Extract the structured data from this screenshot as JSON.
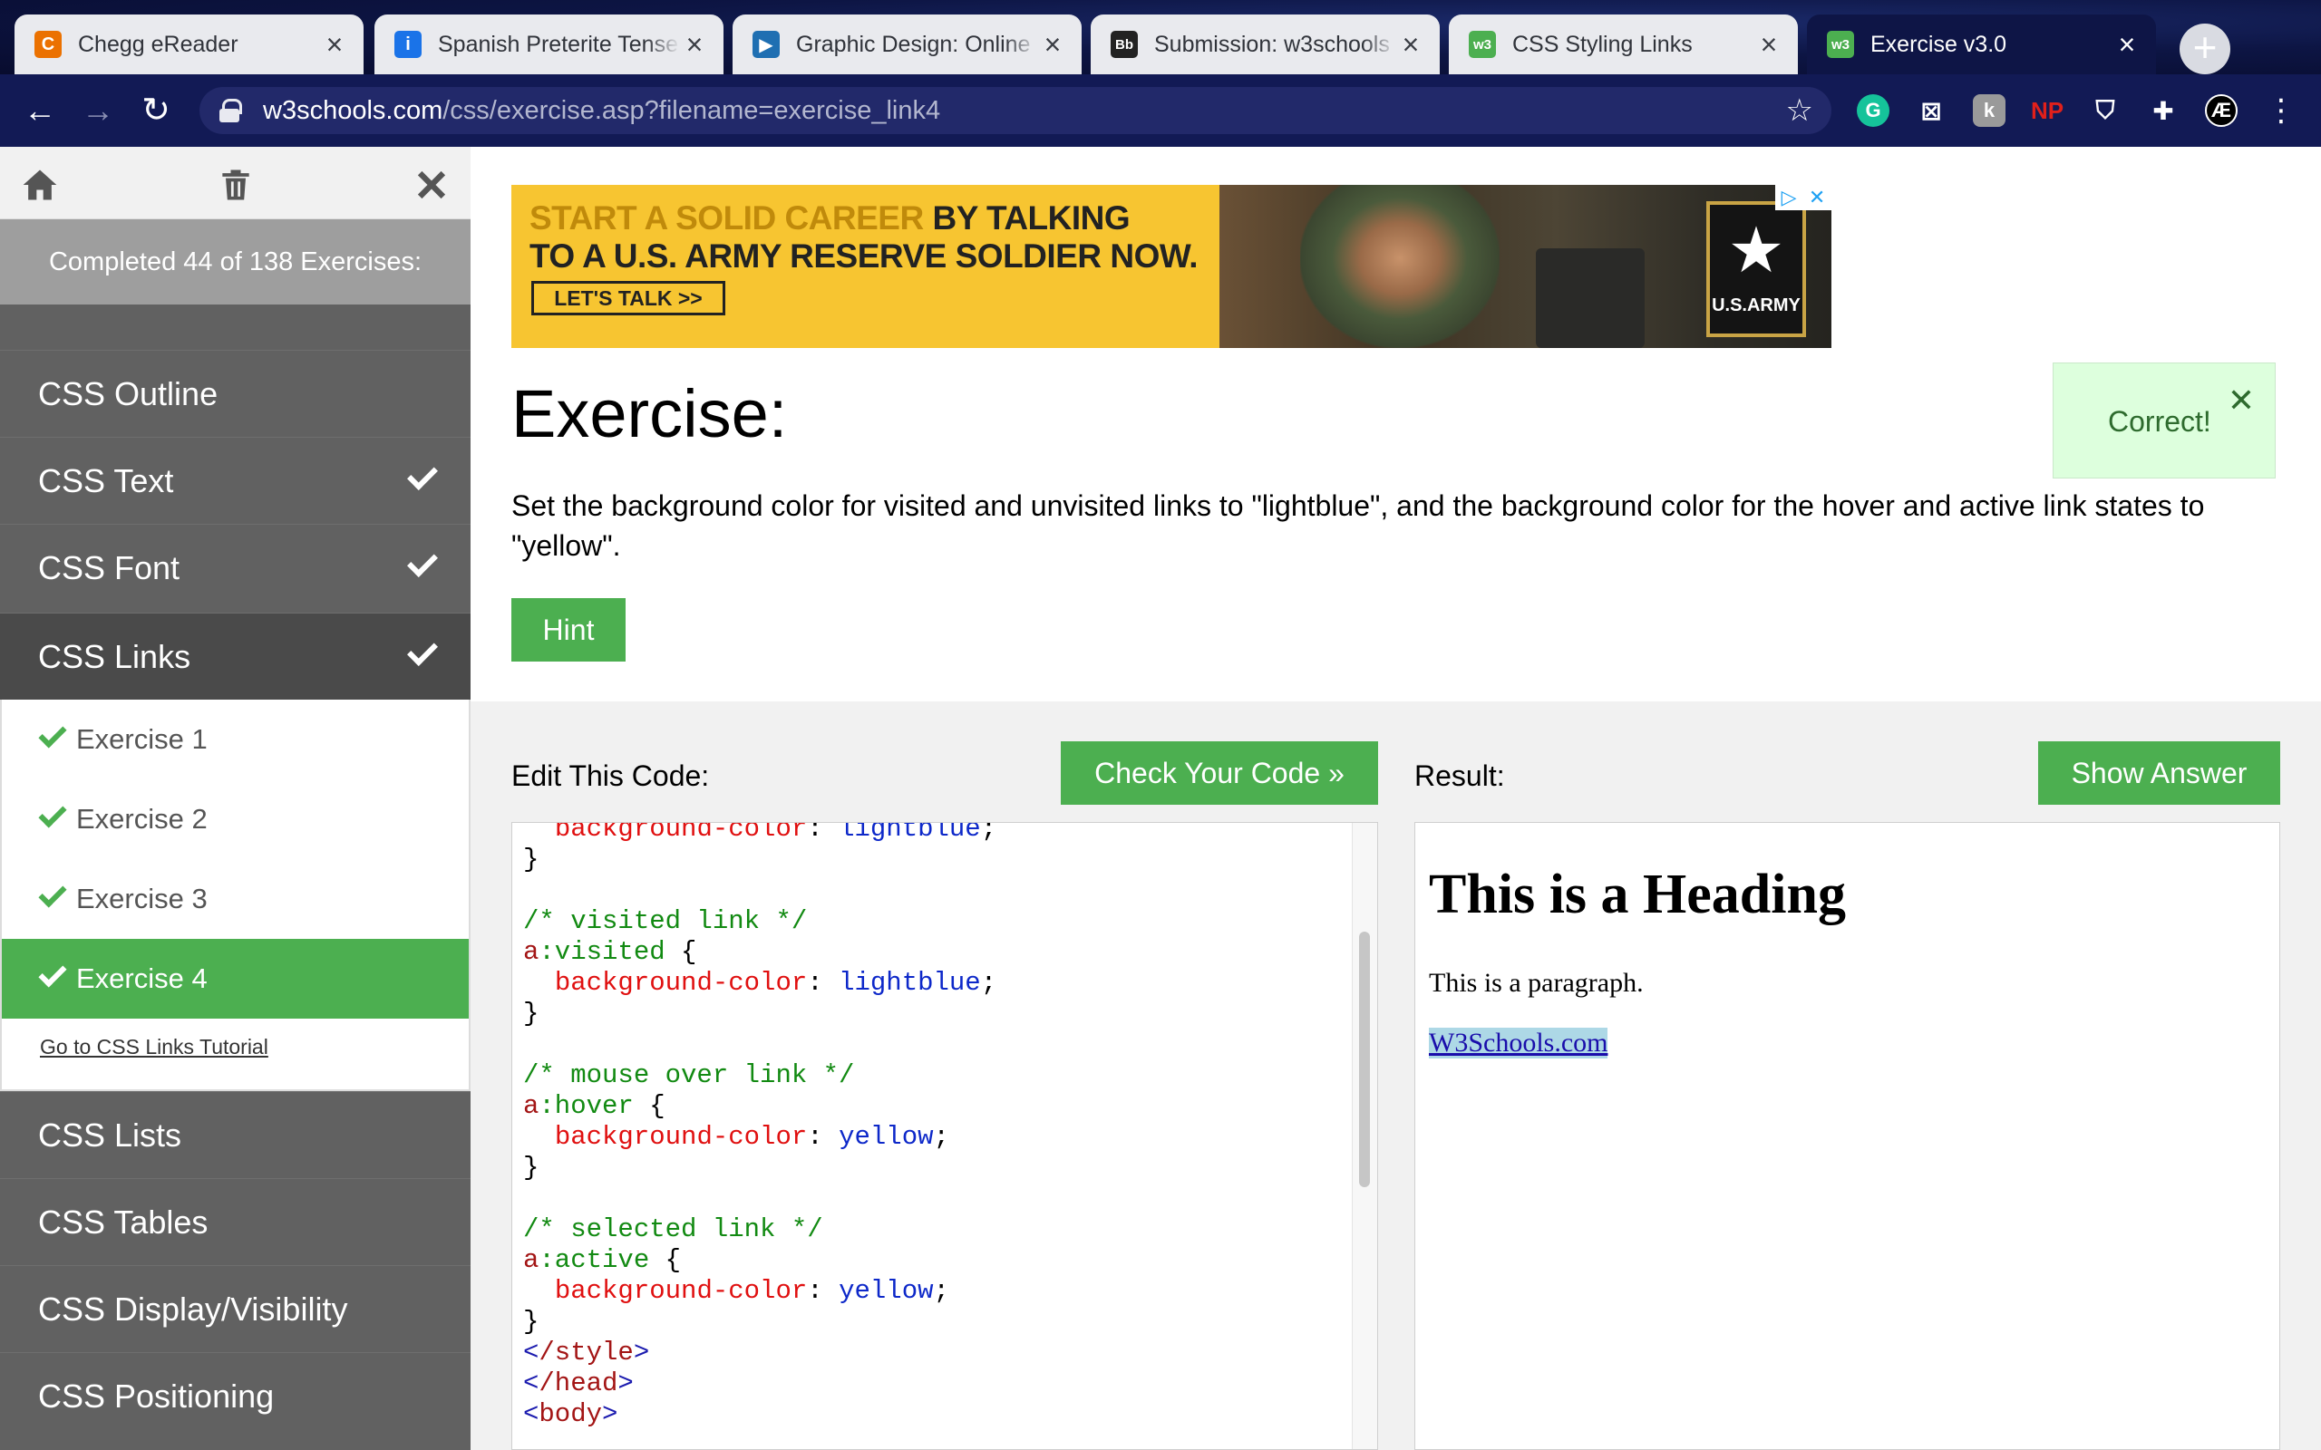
{
  "browser": {
    "tabs": [
      {
        "title": "Chegg eReader",
        "icon": "chegg-icon",
        "icon_color": "#eb7100",
        "icon_glyph": "C"
      },
      {
        "title": "Spanish Preterite Tense",
        "icon": "spanishdict-icon",
        "icon_color": "#1a73e8",
        "icon_glyph": "i"
      },
      {
        "title": "Graphic Design: Online",
        "icon": "video-icon",
        "icon_color": "#1f6fb2",
        "icon_glyph": "▶"
      },
      {
        "title": "Submission: w3schools",
        "icon": "blackboard-icon",
        "icon_color": "#222222",
        "icon_glyph": "Bb"
      },
      {
        "title": "CSS Styling Links",
        "icon": "w3schools-icon",
        "icon_color": "#4caf50",
        "icon_glyph": "w3"
      },
      {
        "title": "Exercise v3.0",
        "icon": "w3schools-icon",
        "icon_color": "#4caf50",
        "icon_glyph": "w3"
      }
    ],
    "url_host": "w3schools.com",
    "url_path": "/css/exercise.asp?filename=exercise_link4",
    "extensions": [
      {
        "name": "grammarly-icon",
        "glyph": "G",
        "color": "#15c39a"
      },
      {
        "name": "extension-x-icon",
        "glyph": "⊠",
        "color": "#333333"
      },
      {
        "name": "extension-k-icon",
        "glyph": "k",
        "color": "#8a8a8a"
      },
      {
        "name": "np-icon",
        "glyph": "NP",
        "color": "#e0201b"
      },
      {
        "name": "adblock-icon",
        "glyph": "⛉",
        "color": "#444444"
      },
      {
        "name": "puzzle-icon",
        "glyph": "✚",
        "color": "#444444"
      },
      {
        "name": "profile-icon",
        "glyph": "Æ",
        "color": "#000000"
      }
    ]
  },
  "sidebar": {
    "progress": "Completed 44 of 138 Exercises:",
    "categories_top": [
      {
        "label": "CSS Outline",
        "done": false
      },
      {
        "label": "CSS Text",
        "done": true
      },
      {
        "label": "CSS Font",
        "done": true
      },
      {
        "label": "CSS Links",
        "done": true
      }
    ],
    "exercises": [
      "Exercise 1",
      "Exercise 2",
      "Exercise 3",
      "Exercise 4"
    ],
    "selected_exercise": 4,
    "tutorial_link": "Go to CSS Links Tutorial",
    "categories_bottom": [
      "CSS Lists",
      "CSS Tables",
      "CSS Display/Visibility",
      "CSS Positioning"
    ]
  },
  "ad": {
    "line1_gold": "START A SOLID CAREER",
    "line1_rest": " BY TALKING",
    "line2": "TO A U.S. ARMY RESERVE SOLDIER NOW.",
    "cta": "LET'S TALK >>",
    "logo_text": "U.S.ARMY"
  },
  "exercise": {
    "title": "Exercise:",
    "instructions": "Set the background color for visited and unvisited links to \"lightblue\", and the background color for the hover and active link states to \"yellow\".",
    "hint": "Hint",
    "feedback": "Correct!"
  },
  "editor": {
    "label": "Edit This Code:",
    "check_button": "Check Your Code »",
    "lines": [
      {
        "indent": "  ",
        "prop": "background-color",
        "val": "lightblue"
      },
      {
        "close": "}"
      },
      {
        "blank": true
      },
      {
        "comment": "/* visited link */"
      },
      {
        "sel": "a",
        "pseudo": ":visited"
      },
      {
        "indent": "  ",
        "prop": "background-color",
        "val": "lightblue"
      },
      {
        "close": "}"
      },
      {
        "blank": true
      },
      {
        "comment": "/* mouse over link */"
      },
      {
        "sel": "a",
        "pseudo": ":hover"
      },
      {
        "indent": "  ",
        "prop": "background-color",
        "val": "yellow"
      },
      {
        "close": "}"
      },
      {
        "blank": true
      },
      {
        "comment": "/* selected link */"
      },
      {
        "sel": "a",
        "pseudo": ":active"
      },
      {
        "indent": "  ",
        "prop": "background-color",
        "val": "yellow"
      },
      {
        "close": "}"
      },
      {
        "tag": "/style"
      },
      {
        "tag": "/head"
      },
      {
        "tag": "body"
      }
    ]
  },
  "result": {
    "label": "Result:",
    "show_answer": "Show Answer",
    "heading": "This is a Heading",
    "paragraph": "This is a paragraph.",
    "link": "W3Schools.com"
  }
}
